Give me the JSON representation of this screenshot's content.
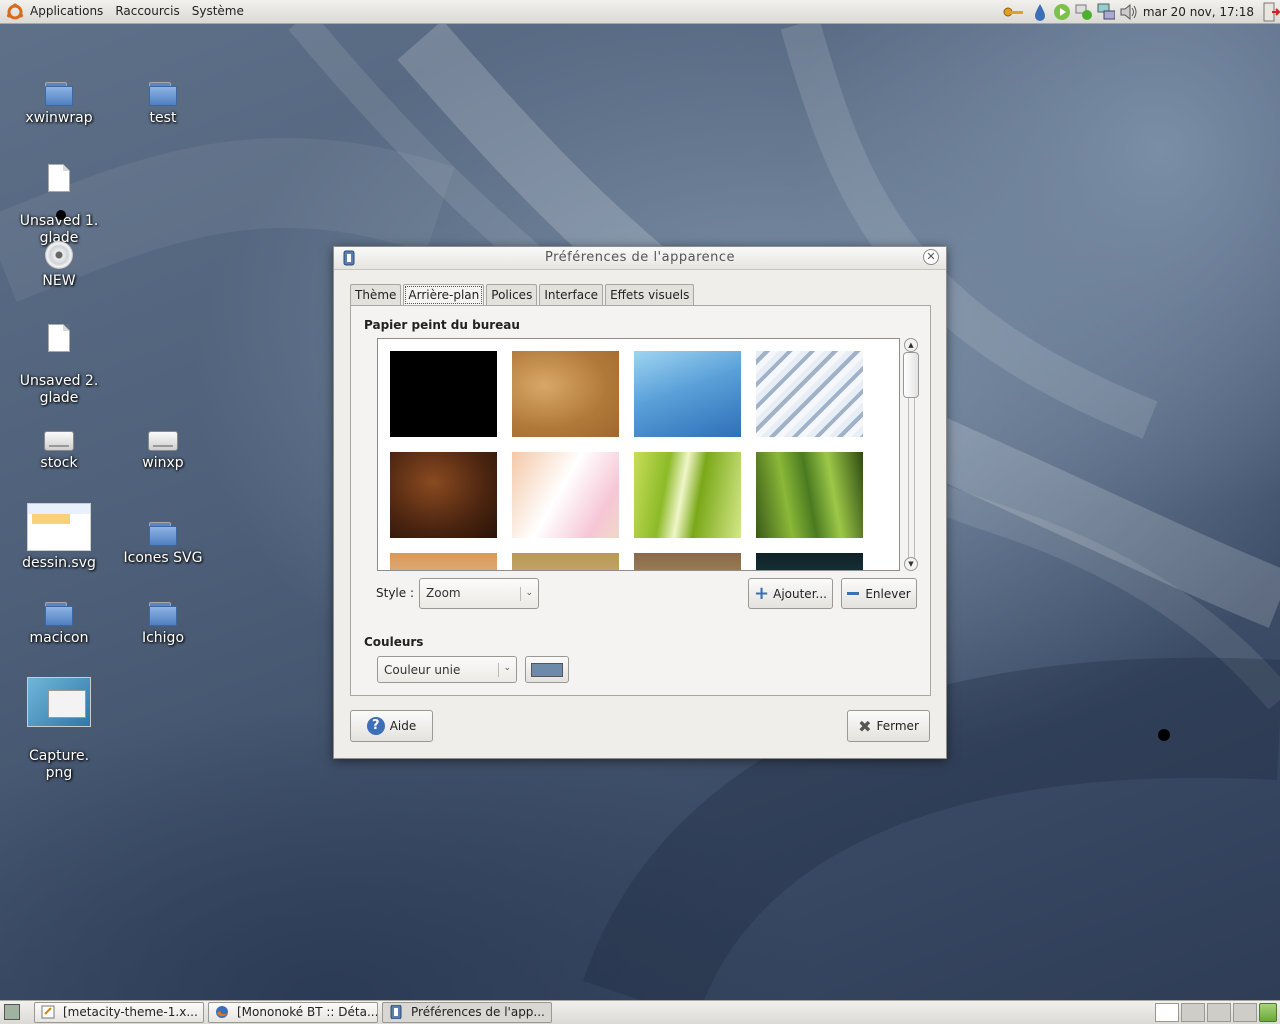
{
  "top_panel": {
    "menus": [
      "Applications",
      "Raccourcis",
      "Système"
    ],
    "clock": "mar 20 nov, 17:18"
  },
  "desktop": {
    "icons": [
      {
        "label": "xwinwrap",
        "type": "folder"
      },
      {
        "label": "test",
        "type": "folder"
      },
      {
        "label": "Unsaved 1.\nglade",
        "type": "document"
      },
      {
        "label": "NEW",
        "type": "disc"
      },
      {
        "label": "Unsaved 2.\nglade",
        "type": "document"
      },
      {
        "label": "stock",
        "type": "drive"
      },
      {
        "label": "winxp",
        "type": "drive"
      },
      {
        "label": "dessin.svg",
        "type": "image"
      },
      {
        "label": "Icones SVG",
        "type": "folder"
      },
      {
        "label": "macicon",
        "type": "folder"
      },
      {
        "label": "Ichigo",
        "type": "folder"
      },
      {
        "label": "Capture.\npng",
        "type": "image"
      }
    ]
  },
  "dialog": {
    "title": "Préférences de l'apparence",
    "tabs": [
      "Thème",
      "Arrière-plan",
      "Polices",
      "Interface",
      "Effets visuels"
    ],
    "active_tab": "Arrière-plan",
    "wallpaper_section": "Papier peint du bureau",
    "style_label": "Style :",
    "style_value": "Zoom",
    "add_button": "Ajouter...",
    "remove_button": "Enlever",
    "colors_section": "Couleurs",
    "color_mode": "Couleur unie",
    "color_value": "#6d8aa8",
    "help_button": "Aide",
    "close_button": "Fermer"
  },
  "taskbar": {
    "tasks": [
      "[metacity-theme-1.x...",
      "[Mononoké BT :: Déta...",
      "Préférences de l'app..."
    ]
  }
}
